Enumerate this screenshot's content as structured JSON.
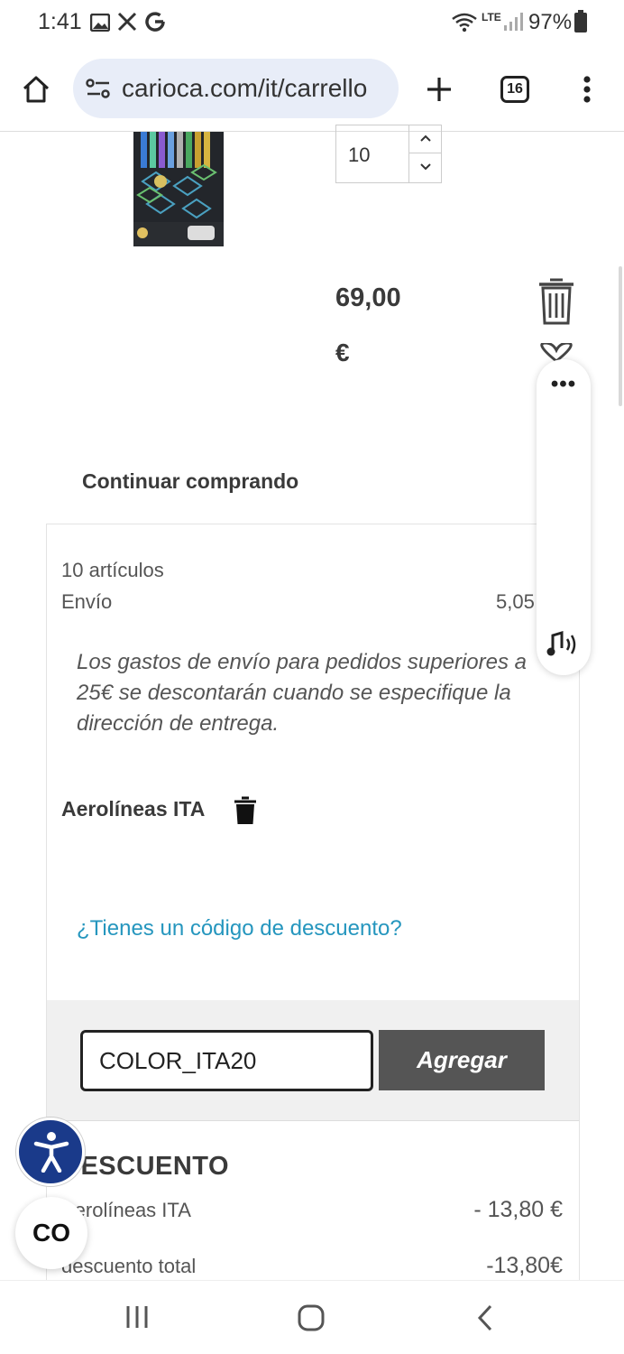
{
  "status_bar": {
    "time": "1:41",
    "network": "LTE",
    "battery": "97%",
    "icons": [
      "gallery-icon",
      "x-icon",
      "google-icon",
      "wifi-icon",
      "signal-icon",
      "battery-icon"
    ]
  },
  "browser": {
    "url": "carioca.com/it/carrello",
    "tabs_count": "16"
  },
  "product": {
    "quantity": "10",
    "price": "69,00",
    "currency": "€"
  },
  "cart": {
    "continue_label": "Continuar comprando",
    "items_label": "10 artículos",
    "shipping_label": "Envío",
    "shipping_value": "5,05",
    "shipping_note": "Los gastos de envío para pedidos superiores a 25€ se descontarán cuando se especifique la dirección de entrega.",
    "voucher_name": "Aerolíneas ITA",
    "discount_link": "¿Tienes un código de descuento?",
    "promo_code": "COLOR_ITA20",
    "add_button": "Agregar",
    "discount_title": "DESCUENTO",
    "discount_rows": [
      {
        "label": "Aerolíneas ITA",
        "value": "- 13,80 €"
      },
      {
        "label": "descuento total",
        "value": "-13,80€"
      }
    ]
  },
  "floating": {
    "co_label": "CO"
  },
  "colors": {
    "accent_link": "#2596be",
    "button_bg": "#555555",
    "accessibility_bg": "#1a3a8a",
    "url_pill_bg": "#e8edf8"
  }
}
